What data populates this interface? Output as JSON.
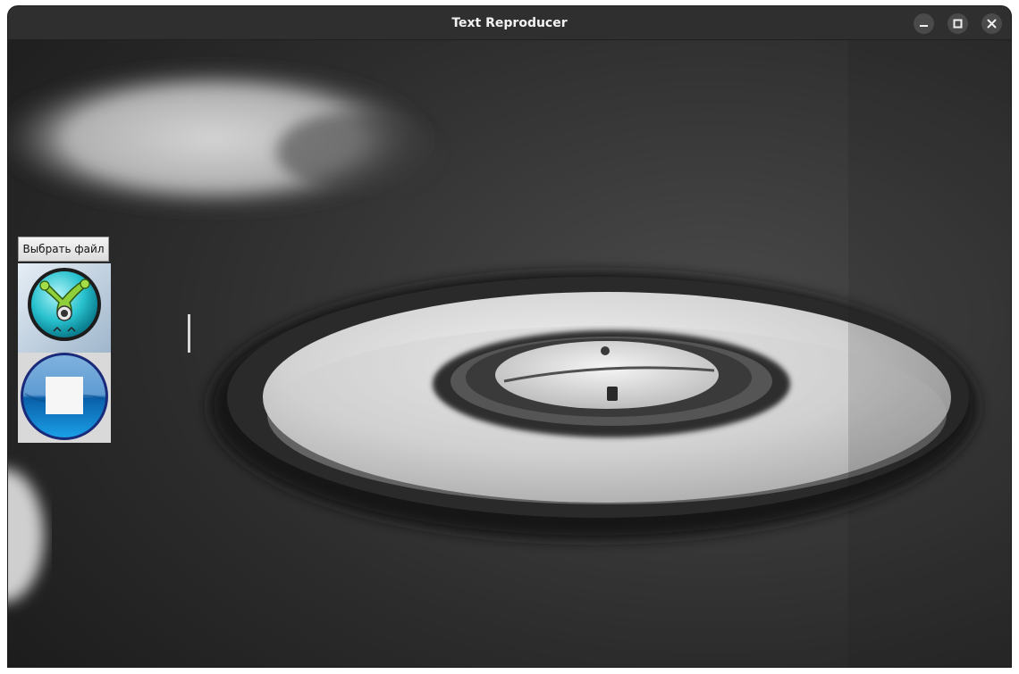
{
  "window": {
    "title": "Text Reproducer",
    "controls": {
      "minimize": "minimize-icon",
      "maximize": "maximize-icon",
      "close": "close-icon"
    }
  },
  "toolbar": {
    "choose_file_label": "Выбрать файл"
  },
  "icons": {
    "app_icon": "webcam-mascot-icon",
    "stop_icon": "stop-icon"
  },
  "colors": {
    "titlebar": "#2f2f2f",
    "title_text": "#f2f2f2",
    "background_photo": "#2a2a2a",
    "stop_button_blue": "#0a6fc4"
  }
}
